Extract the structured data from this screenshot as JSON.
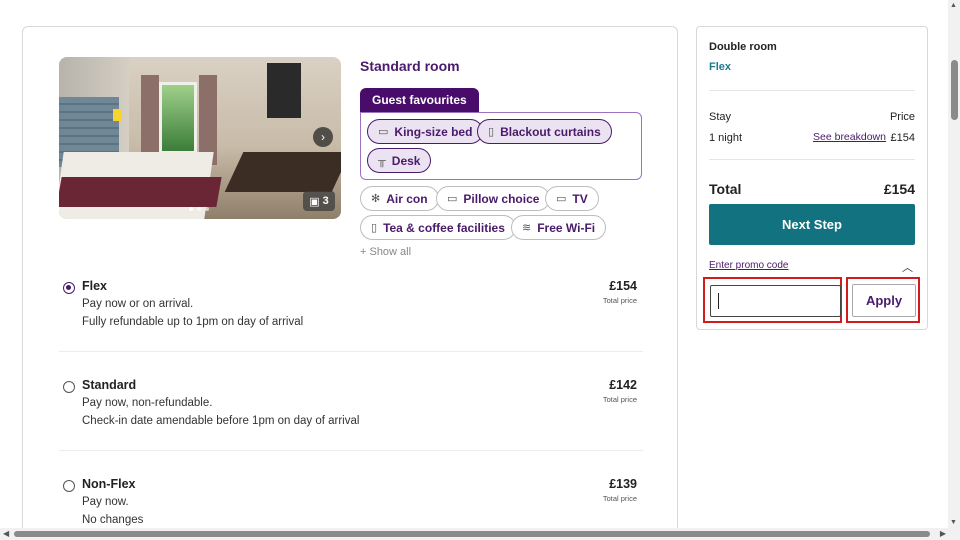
{
  "room": {
    "title": "Standard room",
    "image_count": "3",
    "guest_favourites_label": "Guest favourites",
    "favourites": [
      {
        "label": "King-size bed",
        "icon": "bed-icon"
      },
      {
        "label": "Blackout curtains",
        "icon": "curtains-icon"
      },
      {
        "label": "Desk",
        "icon": "desk-icon"
      }
    ],
    "amenities": [
      {
        "label": "Air con",
        "icon": "snowflake-icon"
      },
      {
        "label": "Pillow choice",
        "icon": "pillow-icon"
      },
      {
        "label": "TV",
        "icon": "tv-icon"
      },
      {
        "label": "Tea & coffee facilities",
        "icon": "cup-icon"
      },
      {
        "label": "Free Wi-Fi",
        "icon": "wifi-icon"
      }
    ],
    "show_all": "+ Show all"
  },
  "rates": [
    {
      "name": "Flex",
      "line1": "Pay now or on arrival.",
      "line2": "Fully refundable up to 1pm on day of arrival",
      "price": "£154",
      "price_label": "Total price",
      "selected": true
    },
    {
      "name": "Standard",
      "line1": "Pay now, non-refundable.",
      "line2": "Check-in date amendable before 1pm on day of arrival",
      "price": "£142",
      "price_label": "Total price",
      "selected": false
    },
    {
      "name": "Non-Flex",
      "line1": "Pay now.",
      "line2": "No changes",
      "price": "£139",
      "price_label": "Total price",
      "selected": false
    }
  ],
  "summary": {
    "room": "Double room",
    "rate": "Flex",
    "stay_label": "Stay",
    "price_label": "Price",
    "nights": "1 night",
    "breakdown_link": "See breakdown",
    "amount": "£154",
    "total_label": "Total",
    "total_amount": "£154",
    "next_button": "Next Step",
    "promo_link": "Enter promo code",
    "promo_value": "",
    "apply_button": "Apply"
  },
  "colors": {
    "brand_purple": "#4a1a6b",
    "teal": "#13727f",
    "highlight_red": "#d11c1c"
  }
}
